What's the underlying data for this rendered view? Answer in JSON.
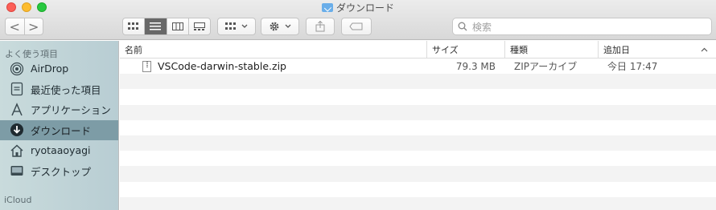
{
  "window": {
    "title": "ダウンロード"
  },
  "toolbar": {
    "back": "<",
    "forward": ">",
    "search_placeholder": "検索"
  },
  "sidebar": {
    "section_favorites": "よく使う項目",
    "items": [
      {
        "label": "AirDrop",
        "icon": "airdrop-icon"
      },
      {
        "label": "最近使った項目",
        "icon": "recents-icon"
      },
      {
        "label": "アプリケーション",
        "icon": "applications-icon"
      },
      {
        "label": "ダウンロード",
        "icon": "downloads-icon",
        "selected": true
      },
      {
        "label": "ryotaaoyagi",
        "icon": "home-icon"
      },
      {
        "label": "デスクトップ",
        "icon": "desktop-icon"
      }
    ],
    "section_icloud": "iCloud"
  },
  "columns": {
    "name": "名前",
    "size": "サイズ",
    "kind": "種類",
    "date": "追加日"
  },
  "files": [
    {
      "name": "VSCode-darwin-stable.zip",
      "size": "79.3 MB",
      "kind": "ZIPアーカイブ",
      "date": "今日 17:47"
    }
  ]
}
